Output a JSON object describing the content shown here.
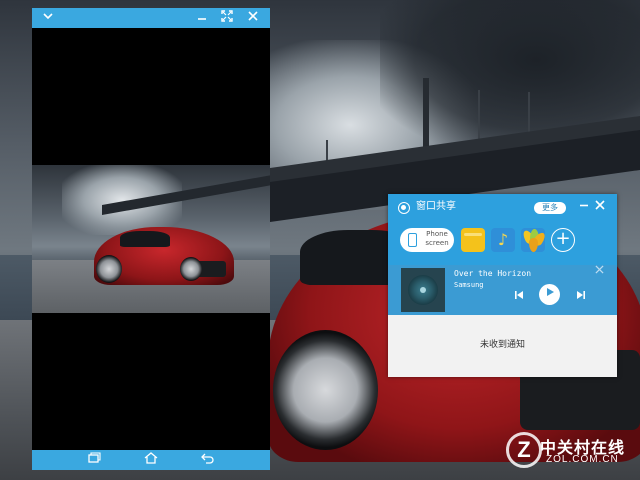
{
  "phone_window": {
    "titlebar_icons": [
      "chevron-down-icon",
      "minimize-icon",
      "expand-icon",
      "close-icon"
    ],
    "navbar_icons": [
      "recent-apps-icon",
      "home-icon",
      "back-icon"
    ]
  },
  "share_panel": {
    "title": "窗口共享",
    "more_label": "更多",
    "controls": [
      "minimize-icon",
      "close-icon"
    ],
    "phone_screen_label": "Phone screen",
    "apps": [
      "notes-app-icon",
      "music-app-icon",
      "gallery-app-icon",
      "add-icon"
    ],
    "now_playing": {
      "song": "Over the Horizon",
      "artist": "Samsung"
    },
    "notification_text": "未收到通知"
  },
  "watermark": {
    "logo_letter": "Z",
    "cn_text": "中关村在线",
    "en_text": "ZOL.COM.CN"
  },
  "colors": {
    "accent": "#2da0de",
    "titlebar": "#3aa8e0",
    "music_bar": "#3b9bd3"
  }
}
